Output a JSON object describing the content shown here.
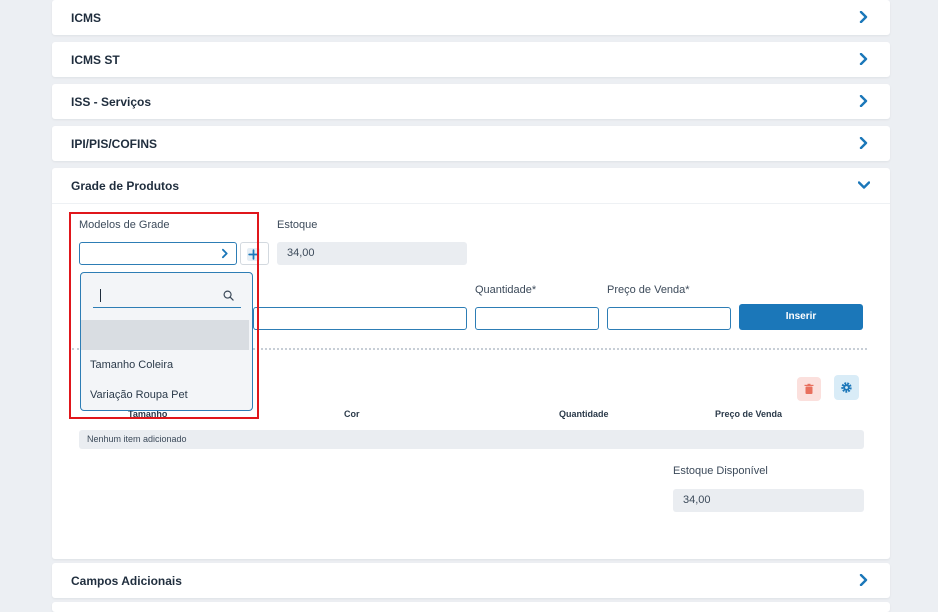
{
  "accordion": {
    "icms": "ICMS",
    "icms_st": "ICMS ST",
    "iss": "ISS - Serviços",
    "ipi": "IPI/PIS/COFINS",
    "grade": "Grade de Produtos",
    "campos": "Campos Adicionais"
  },
  "grade": {
    "modelos_label": "Modelos de Grade",
    "modelos_value": "",
    "estoque_label": "Estoque",
    "estoque_value": "34,00",
    "quantidade_label": "Quantidade*",
    "preco_label": "Preço de Venda*",
    "insert_button": "Inserir",
    "dropdown": {
      "search_value": "",
      "options": [
        "Tamanho Coleira",
        "Variação Roupa Pet"
      ]
    },
    "table": {
      "headers": [
        "Tamanho",
        "Cor",
        "Quantidade",
        "Preço de Venda"
      ],
      "empty_message": "Nenhum item adicionado"
    },
    "estoque_disponivel_label": "Estoque Disponível",
    "estoque_disponivel_value": "34,00"
  },
  "colors": {
    "primary": "#1b77b9",
    "highlight_border": "#e0161b",
    "delete_bg": "#fbe0dd",
    "delete_icon": "#e8705e",
    "settings_bg": "#d9ecf7"
  },
  "icons": [
    "chevron-right-icon",
    "chevron-down-icon",
    "plus-icon",
    "search-icon",
    "trash-icon",
    "gear-icon"
  ]
}
